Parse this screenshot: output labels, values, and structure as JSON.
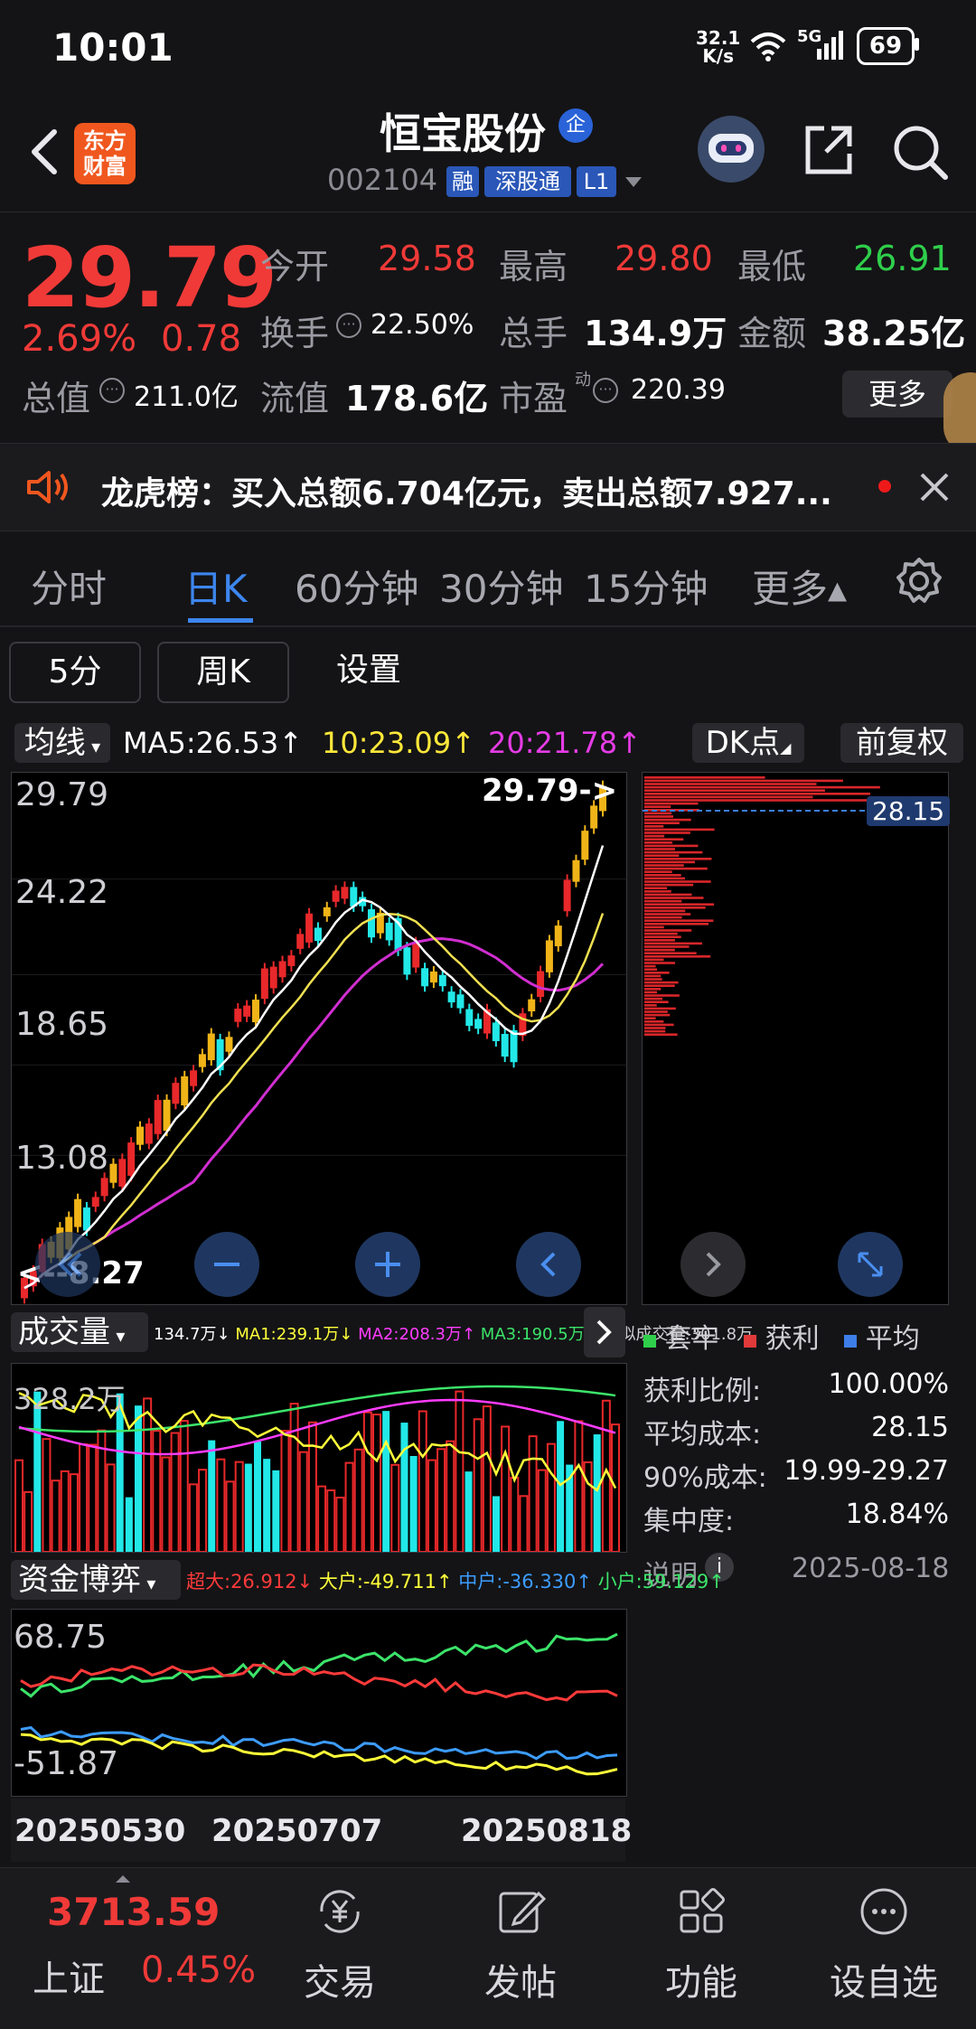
{
  "status": {
    "time": "10:01",
    "net_speed": "32.1",
    "net_unit": "K/s",
    "net_type": "5G",
    "battery": "69"
  },
  "header": {
    "app_logo": "东方财富",
    "stock_name": "恒宝股份",
    "name_tag": "企",
    "stock_code": "002104",
    "tags": [
      "融",
      "深股通",
      "L1"
    ]
  },
  "quote": {
    "price": "29.79",
    "change_percent": "2.69%",
    "change": "0.78",
    "fields": [
      {
        "label": "今开",
        "value": "29.58",
        "color": "#f03a38"
      },
      {
        "label": "最高",
        "value": "29.80",
        "color": "#f03a38"
      },
      {
        "label": "最低",
        "value": "26.91",
        "color": "#2fcf4b"
      },
      {
        "label": "换手",
        "value": "22.50%",
        "color": "#ffffff"
      },
      {
        "label": "总手",
        "value": "134.9万",
        "color": "#ffffff"
      },
      {
        "label": "金额",
        "value": "38.25亿",
        "color": "#ffffff"
      },
      {
        "label": "总值",
        "value": "211.0亿",
        "color": "#ffffff"
      },
      {
        "label": "流值",
        "value": "178.6亿",
        "color": "#ffffff"
      },
      {
        "label": "市盈",
        "value": "220.39",
        "color": "#ffffff"
      }
    ],
    "pe_superscript": "动",
    "more_label": "更多"
  },
  "announcement": {
    "text": "龙虎榜：买入总额6.704亿元，卖出总额7.927..."
  },
  "tabs": [
    "分时",
    "日K",
    "60分钟",
    "30分钟",
    "15分钟",
    "更多▴"
  ],
  "active_tab": "日K",
  "sub_buttons": [
    "5分",
    "周K",
    "设置"
  ],
  "ma_line": {
    "selector": "均线",
    "ma5": "MA5:26.53↑",
    "ma10": "10:23.09↑",
    "ma20": "20:21.78↑",
    "dk": "DK点",
    "fq": "前复权"
  },
  "kline": {
    "y_labels": [
      "29.79",
      "24.22",
      "18.65",
      "13.08",
      "8.27"
    ],
    "max_label": "29.79->",
    "min_label": "<--8.27",
    "chip_avg_label": "28.15"
  },
  "volume": {
    "selector": "成交量",
    "legend": [
      {
        "text": "134.7万↓",
        "color": "#ffffff"
      },
      {
        "text": "MA1:239.1万↓",
        "color": "#ffff3a"
      },
      {
        "text": "MA2:208.3万↑",
        "color": "#ff3cff"
      },
      {
        "text": "MA3:190.5万↓",
        "color": "#3ce46a"
      },
      {
        "text": "虚拟成交量:301.8万",
        "color": "#cfcfd4"
      }
    ],
    "y_label": "328.2万"
  },
  "chips": {
    "legend": [
      {
        "text": "套牢",
        "color": "#2fcf4b"
      },
      {
        "text": "获利",
        "color": "#e03a3a"
      },
      {
        "text": "平均",
        "color": "#3d7ee8"
      }
    ],
    "rows": [
      {
        "label": "获利比例:",
        "value": "100.00%"
      },
      {
        "label": "平均成本:",
        "value": "28.15"
      },
      {
        "label": "90%成本:",
        "value": "19.99-29.27"
      },
      {
        "label": "集中度:",
        "value": "18.84%"
      }
    ],
    "note": "说明",
    "date": "2025-08-18"
  },
  "funds": {
    "selector": "资金博弈",
    "legend": [
      {
        "text": "超大:26.912↓",
        "color": "#ff3a3a"
      },
      {
        "text": "大户:-49.711↑",
        "color": "#ffff3a"
      },
      {
        "text": "中户:-36.330↑",
        "color": "#3d9cff"
      },
      {
        "text": "小户:59.129↑",
        "color": "#3ce46a"
      }
    ],
    "y_labels": [
      "68.75",
      "-51.87"
    ]
  },
  "dates": [
    "20250530",
    "20250707",
    "20250818"
  ],
  "bottom": {
    "index_value": "3713.59",
    "index_name": "上证",
    "index_change": "0.45%",
    "nav": [
      "交易",
      "发帖",
      "功能",
      "设自选"
    ]
  },
  "colors": {
    "up": "#f03a38",
    "down": "#2fcf4b",
    "accent": "#3d86ee",
    "background": "#141416"
  }
}
